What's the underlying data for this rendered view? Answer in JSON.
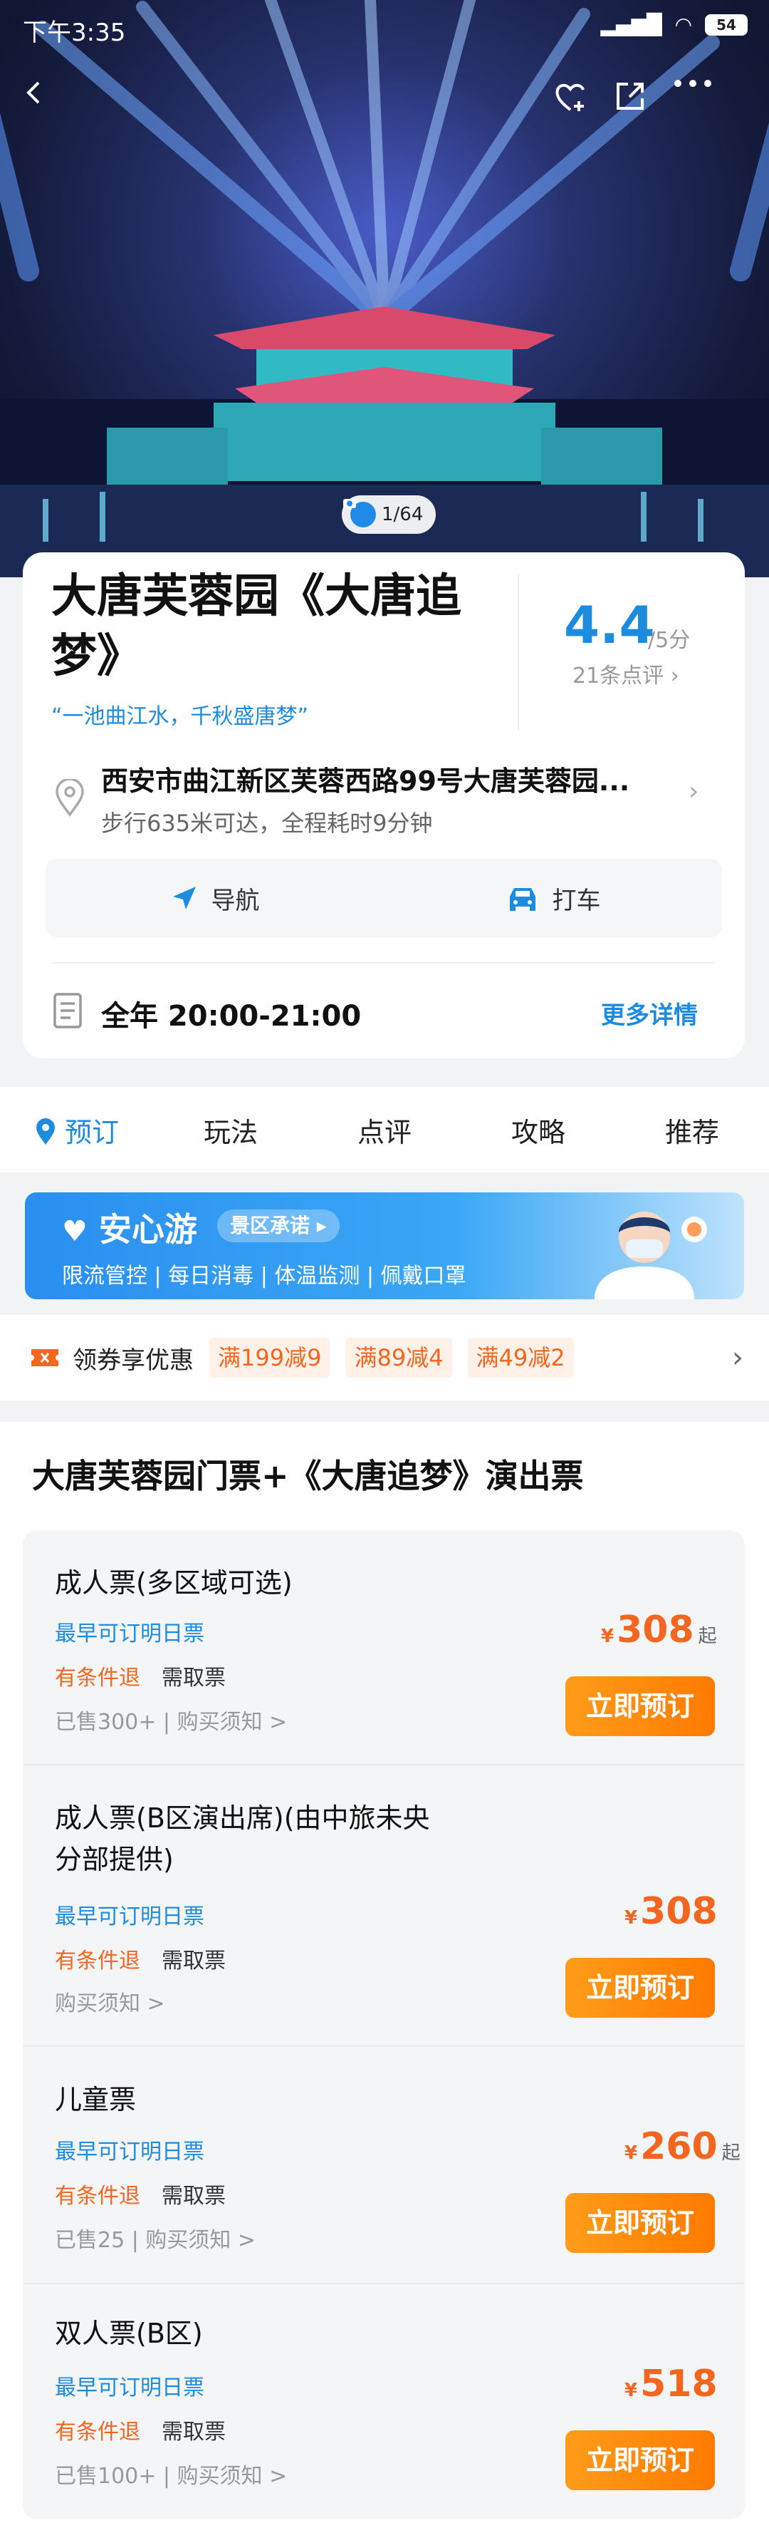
{
  "status": {
    "time": "下午3:35",
    "battery": "54"
  },
  "hero": {
    "photo_count": "1/64"
  },
  "info": {
    "title": "大唐芙蓉园《大唐追梦》",
    "slogan": "“一池曲江水，千秋盛唐梦”",
    "score": "4.4",
    "score_unit": "/5分",
    "reviews": "21条点评",
    "address": "西安市曲江新区芙蓉西路99号大唐芙蓉园...",
    "walk": "步行635米可达，全程耗时9分钟",
    "nav_label": "导航",
    "taxi_label": "打车",
    "hours": "全年 20:00-21:00",
    "more": "更多详情"
  },
  "tabs": [
    "预订",
    "玩法",
    "点评",
    "攻略",
    "推荐"
  ],
  "banner": {
    "brand": "安心游",
    "promise": "景区承诺 ▸",
    "items": "限流管控 | 每日消毒 | 体温监测 | 佩戴口罩"
  },
  "coupon": {
    "label": "领券享优惠",
    "tags": [
      "满199减9",
      "满89减4",
      "满49减2"
    ]
  },
  "section": {
    "title": "大唐芙蓉园门票+《大唐追梦》演出票",
    "tickets": [
      {
        "name": "成人票(多区域可选)",
        "early": "最早可订明日票",
        "refund": "有条件退",
        "pickup": "需取票",
        "sold": "已售300+ | 购买须知 >",
        "currency": "¥",
        "price": "308",
        "suffix": "起",
        "book": "立即预订"
      },
      {
        "name": "成人票(B区演出席)(由中旅未央分部提供)",
        "early": "最早可订明日票",
        "refund": "有条件退",
        "pickup": "需取票",
        "sold": "购买须知 >",
        "currency": "¥",
        "price": "308",
        "suffix": "",
        "book": "立即预订"
      },
      {
        "name": "儿童票",
        "early": "最早可订明日票",
        "refund": "有条件退",
        "pickup": "需取票",
        "sold": "已售25 | 购买须知 >",
        "currency": "¥",
        "price": "260",
        "suffix": "起",
        "book": "立即预订"
      },
      {
        "name": "双人票(B区)",
        "early": "最早可订明日票",
        "refund": "有条件退",
        "pickup": "需取票",
        "sold": "已售100+ | 购买须知 >",
        "currency": "¥",
        "price": "518",
        "suffix": "",
        "book": "立即预订"
      }
    ]
  }
}
